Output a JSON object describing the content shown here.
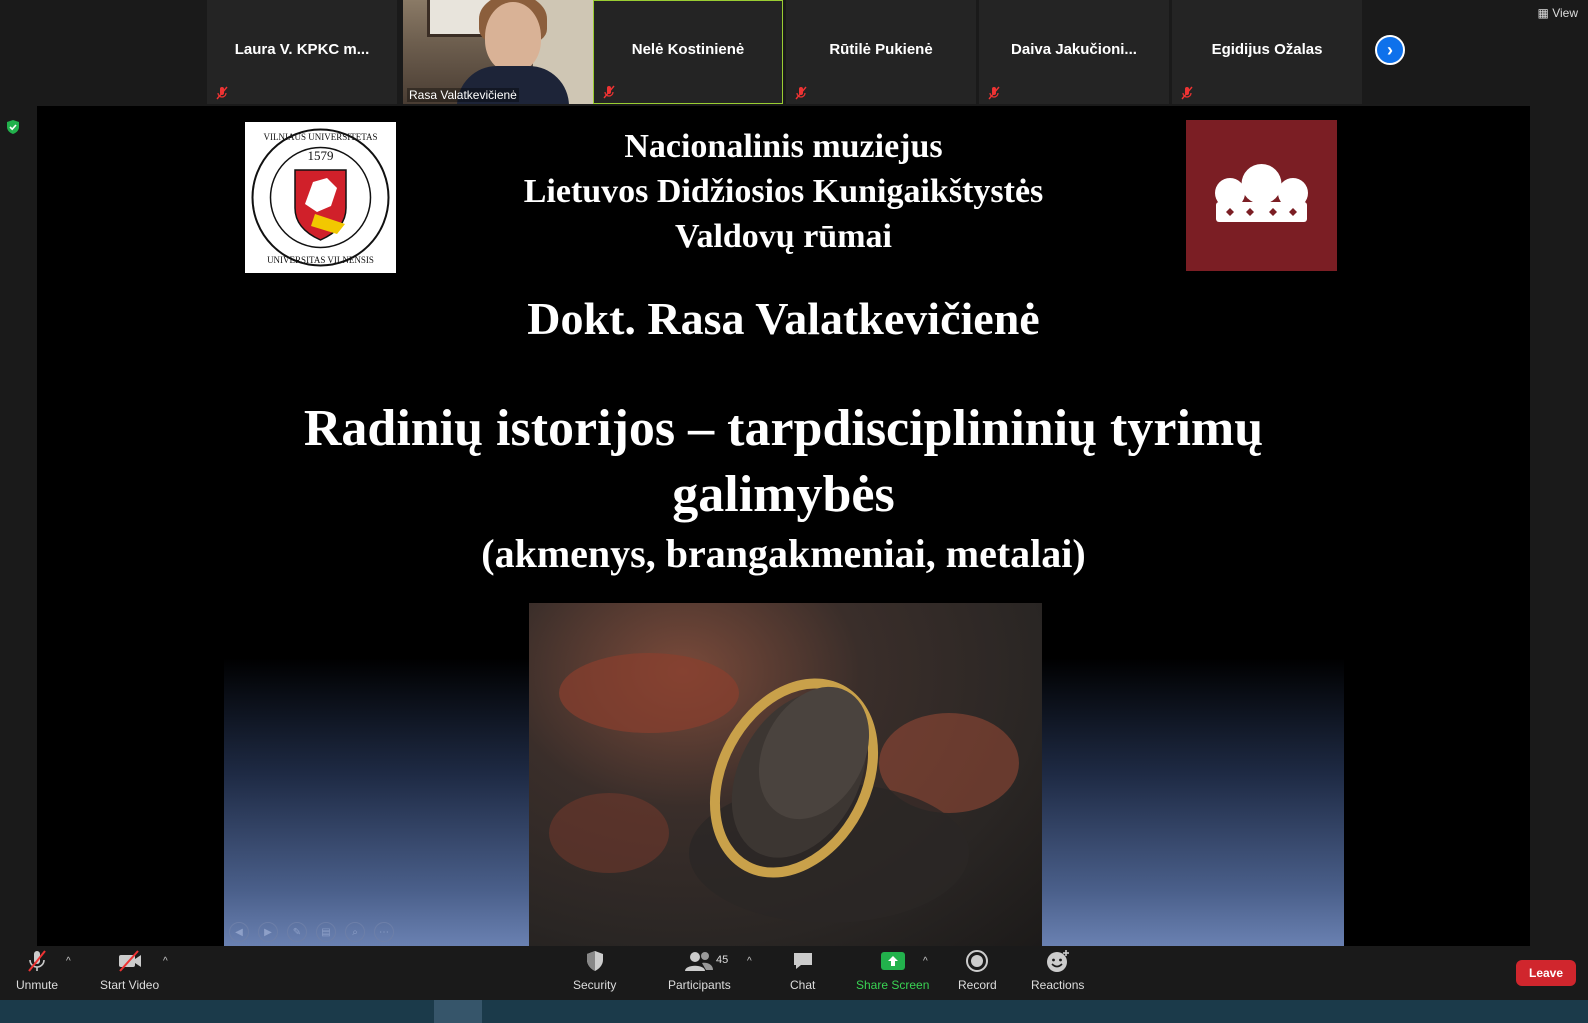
{
  "participants": [
    {
      "name": "Laura V. KPKC m...",
      "muted": true
    },
    {
      "name": "Rasa Valatkevičienė",
      "muted": false,
      "video": true
    },
    {
      "name": "Nelė Kostinienė",
      "muted": true,
      "active": true
    },
    {
      "name": "Rūtilė Pukienė",
      "muted": true
    },
    {
      "name": "Daiva  Jakučioni...",
      "muted": true
    },
    {
      "name": "Egidijus Ožalas",
      "muted": true
    }
  ],
  "view_label": "View",
  "slide": {
    "institution_lines": [
      "Nacionalinis muziejus",
      "Lietuvos Didžiosios Kunigaikštystės",
      "Valdovų rūmai"
    ],
    "author": "Dokt. Rasa Valatkevičienė",
    "title_line1": "Radinių istorijos – tarpdisciplininių tyrimų",
    "title_line2": "galimybės",
    "subtitle": "(akmenys, brangakmeniai, metalai)",
    "vu_logo_text": "VILNIAUS UNIVERSITETAS · 1579 · UNIVERSITAS VILNENSIS"
  },
  "toolbar": {
    "unmute": "Unmute",
    "start_video": "Start Video",
    "security": "Security",
    "participants": "Participants",
    "participants_count": "45",
    "chat": "Chat",
    "share_screen": "Share Screen",
    "record": "Record",
    "reactions": "Reactions",
    "leave": "Leave"
  },
  "colors": {
    "accent_blue": "#0e71eb",
    "share_green": "#39d353",
    "leave_red": "#d0262d",
    "crown_bg": "#7b1e24"
  }
}
